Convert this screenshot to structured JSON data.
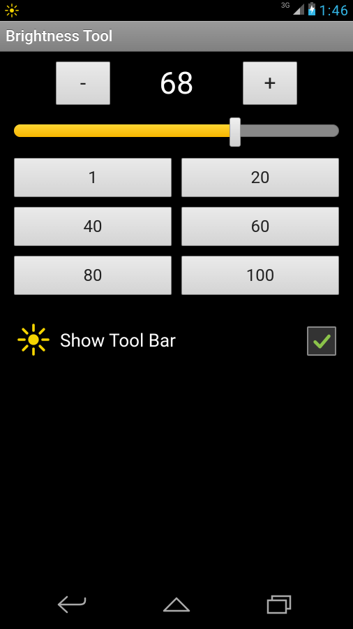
{
  "status": {
    "network": "3G",
    "clock": "1:46"
  },
  "actionbar": {
    "title": "Brightness Tool"
  },
  "controls": {
    "minus_label": "-",
    "plus_label": "+",
    "value": "68",
    "slider_percent": 68
  },
  "presets": [
    {
      "label": "1"
    },
    {
      "label": "20"
    },
    {
      "label": "40"
    },
    {
      "label": "60"
    },
    {
      "label": "80"
    },
    {
      "label": "100"
    }
  ],
  "toolbar_toggle": {
    "label": "Show Tool Bar",
    "checked": true
  }
}
